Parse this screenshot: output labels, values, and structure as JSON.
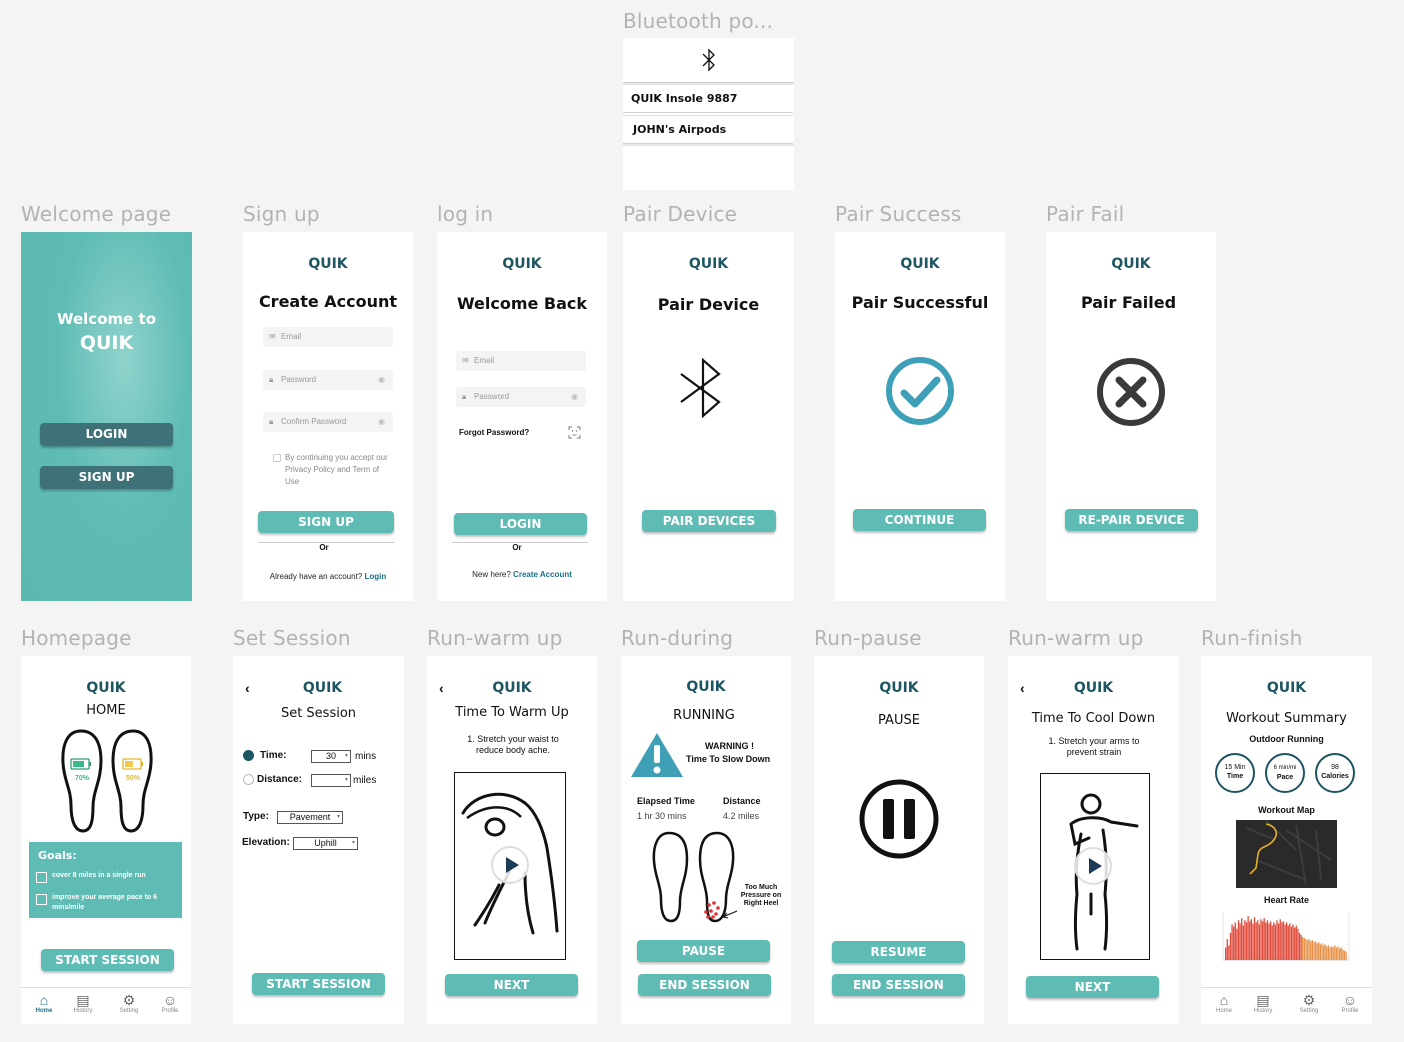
{
  "brand": "QUIK",
  "frames": {
    "bluetooth": "Bluetooth po...",
    "welcome": "Welcome page",
    "signup": "Sign up",
    "login": "log in",
    "pair": "Pair Device",
    "success": "Pair Success",
    "fail": "Pair Fail",
    "home": "Homepage",
    "set": "Set Session",
    "warm": "Run-warm up",
    "during": "Run-during",
    "pause": "Run-pause",
    "cool": "Run-warm up",
    "finish": "Run-finish"
  },
  "bluetooth": {
    "devices": [
      "QUIK Insole 9887",
      "JOHN's Airpods"
    ]
  },
  "welcome": {
    "line1": "Welcome to",
    "line2": "QUIK",
    "login": "LOGIN",
    "signup": "SIGN UP"
  },
  "signup": {
    "title": "Create Account",
    "email": "Email",
    "password": "Password",
    "confirm": "Confirm Password",
    "terms": "By continuing you accept our Privacy Policy and Term of Use",
    "button": "SIGN UP",
    "or": "Or",
    "have": "Already have an account?",
    "login_link": "Login"
  },
  "login": {
    "title": "Welcome Back",
    "email": "Email",
    "password": "Password",
    "forgot": "Forgot Password?",
    "button": "LOGIN",
    "or": "Or",
    "new": "New here?",
    "create_link": "Create Account"
  },
  "pair": {
    "title": "Pair Device",
    "button": "PAIR DEVICES"
  },
  "success": {
    "title": "Pair Successful",
    "button": "CONTINUE"
  },
  "fail": {
    "title": "Pair Failed",
    "button": "RE-PAIR DEVICE"
  },
  "home": {
    "title": "HOME",
    "left_battery": "70%",
    "right_battery": "50%",
    "goals_title": "Goals:",
    "goals": [
      "cover 8 miles in a single run",
      "improve your average pace to 6 mins/mile"
    ],
    "button": "START SESSION"
  },
  "nav": [
    "Home",
    "History",
    "Setting",
    "Profile"
  ],
  "set": {
    "title": "Set Session",
    "time_label": "Time:",
    "time_value": "30",
    "time_unit": "mins",
    "distance_label": "Distance:",
    "distance_unit": "miles",
    "type_label": "Type:",
    "type_value": "Pavement",
    "elev_label": "Elevation:",
    "elev_value": "Uphill",
    "button": "START SESSION"
  },
  "warm": {
    "title": "Time To Warm Up",
    "instruction": "1. Stretch your waist to reduce body ache.",
    "button": "NEXT"
  },
  "during": {
    "title": "RUNNING",
    "warn1": "WARNING !",
    "warn2": "Time To Slow Down",
    "elapsed_label": "Elapsed Time",
    "elapsed_value": "1 hr 30 mins",
    "distance_label": "Distance",
    "distance_value": "4.2 miles",
    "pressure_note": "Too Much Pressure on Right Heel",
    "pause": "PAUSE",
    "end": "END SESSION"
  },
  "pause": {
    "title": "PAUSE",
    "resume": "RESUME",
    "end": "END SESSION"
  },
  "cool": {
    "title": "Time To Cool Down",
    "instruction": "1. Stretch your arms to prevent strain",
    "button": "NEXT"
  },
  "finish": {
    "title": "Workout Summary",
    "subtitle": "Outdoor Running",
    "stats": [
      {
        "value": "15 Min",
        "label": "Time"
      },
      {
        "value": "6 min/mi",
        "label": "Pace"
      },
      {
        "value": "98",
        "label": "Calories"
      }
    ],
    "map_label": "Workout Map",
    "hr_label": "Heart Rate"
  },
  "colors": {
    "teal": "#5fbcb4",
    "dark_teal": "#3f7278",
    "brand": "#1d5561",
    "check": "#3ea0b8",
    "warning": "#3f9fb5"
  },
  "heart_rate": {
    "values": [
      12,
      20,
      14,
      26,
      34,
      32,
      36,
      30,
      38,
      35,
      40,
      33,
      38,
      36,
      42,
      37,
      39,
      35,
      41,
      36,
      38,
      34,
      39,
      37,
      40,
      36,
      38,
      35,
      37,
      33,
      36,
      34,
      38,
      35,
      39,
      36,
      37,
      34,
      36,
      33,
      35,
      32,
      34,
      31,
      33,
      30,
      26,
      24,
      22,
      21,
      20,
      19,
      20,
      18,
      19,
      17,
      18,
      16,
      17,
      15,
      16,
      14,
      15,
      13,
      14,
      12,
      13,
      12,
      14,
      12,
      13,
      11,
      12,
      10,
      9,
      8
    ]
  }
}
